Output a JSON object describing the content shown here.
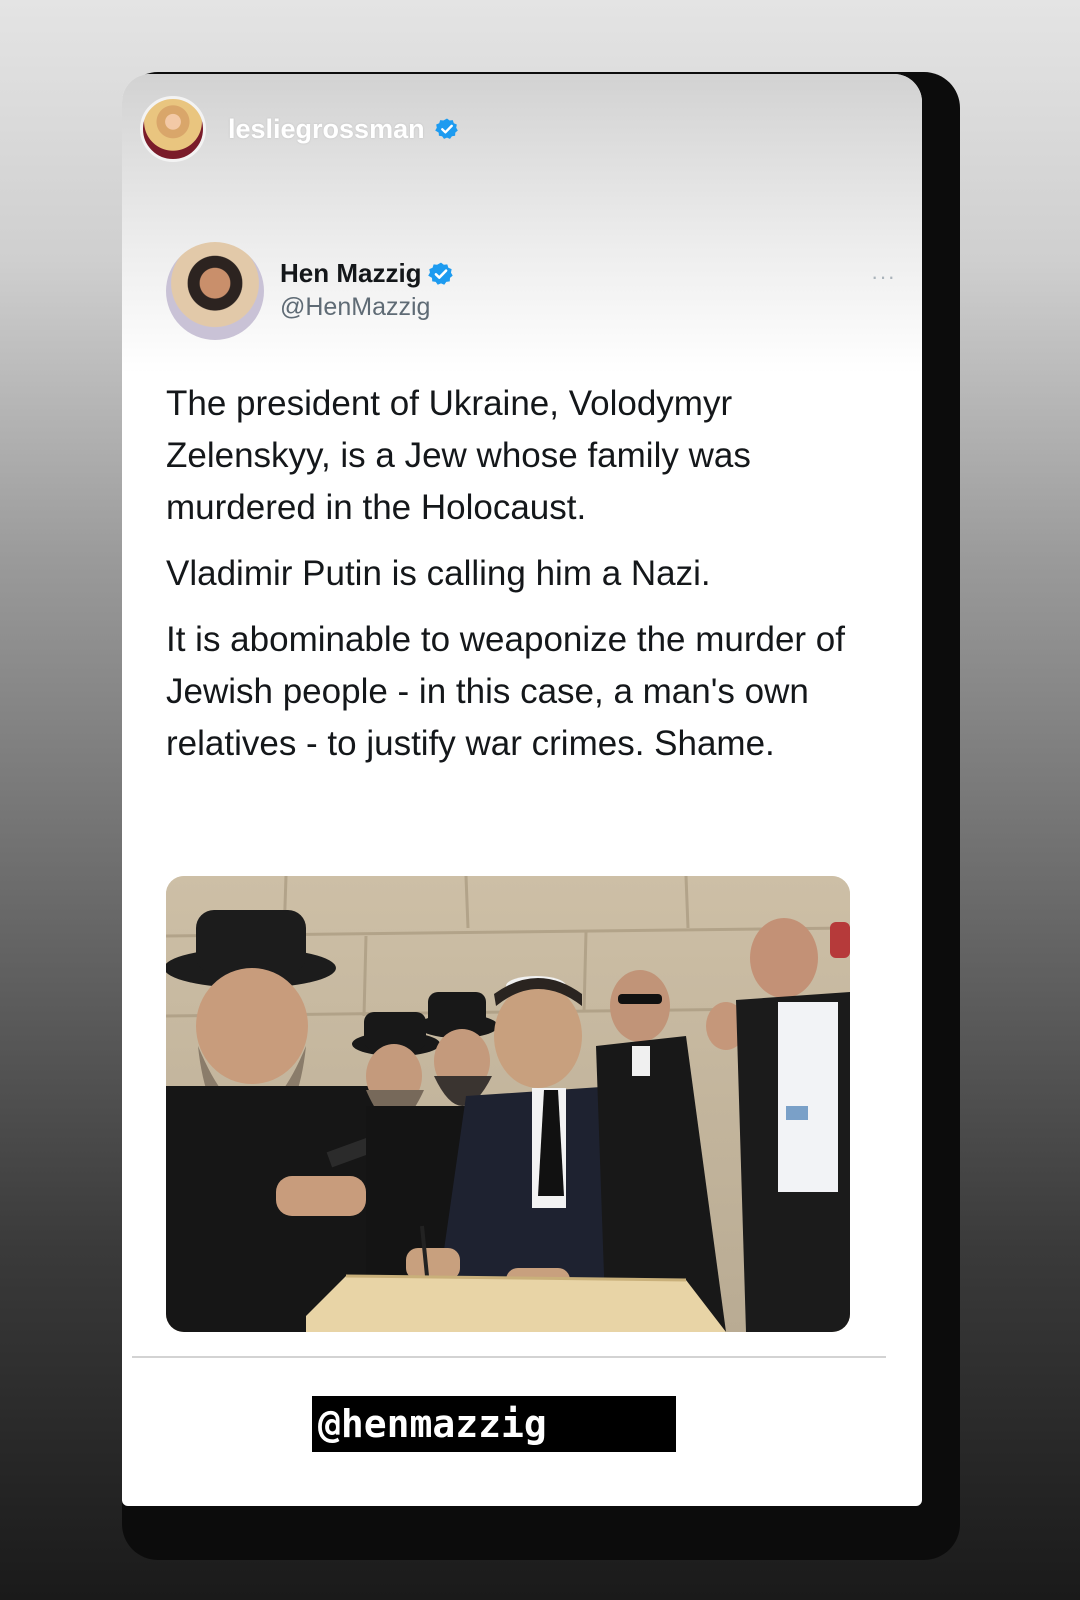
{
  "story": {
    "username": "lesliegrossman",
    "avatar_icon": "profile-photo-icon",
    "verified_icon": "verified-badge-icon",
    "mention_sticker": "@henmazzig"
  },
  "tweet": {
    "author_name": "Hen Mazzig",
    "author_handle": "@HenMazzig",
    "more_label": "···",
    "paragraphs": [
      "The president of Ukraine, Volodymyr Zelenskyy, is a Jew whose family was murdered in the Holocaust.",
      "Vladimir Putin is calling him a Nazi.",
      "It is abominable to weaponize the murder of Jewish people - in this case, a man's own relatives - to justify war crimes. Shame."
    ],
    "photo_icon": "tweet-photo-icon"
  },
  "colors": {
    "verified_blue": "#1d9bf0",
    "text_dark": "#14171a",
    "text_muted": "#5f6b75",
    "sticker_bg": "#000000"
  }
}
